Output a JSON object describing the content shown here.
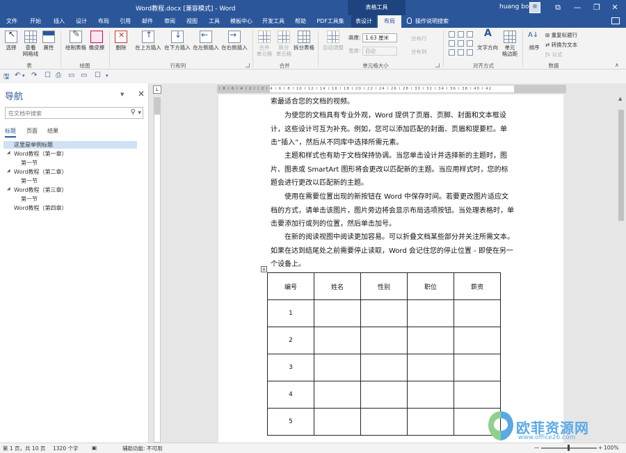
{
  "titlebar": {
    "document_title": "Word教程.docx [兼容模式] - Word",
    "contextual_group": "表格工具",
    "user_name": "huang bo",
    "controls": {
      "ribbon_options": "⧉",
      "minimize": "—",
      "restore": "❐",
      "close": "✕"
    }
  },
  "tabs": {
    "file": "文件",
    "home": "开始",
    "insert": "插入",
    "design": "设计",
    "layout": "布局",
    "references": "引用",
    "mailings": "邮件",
    "review": "审阅",
    "view": "视图",
    "tools": "工具",
    "template_center": "模板中心",
    "developer": "开发工具",
    "help": "帮助",
    "pdf_tools": "PDF工具集",
    "table_design": "表设计",
    "table_layout": "布局",
    "tell_me": "操作说明搜索"
  },
  "ribbon": {
    "table_group": {
      "label": "表",
      "select": "选择",
      "view_gridlines": "查看\n网格线",
      "properties": "属性"
    },
    "draw_group": {
      "label": "绘图",
      "draw_table": "绘制表格",
      "eraser": "橡皮擦"
    },
    "rows_cols_group": {
      "label": "行和列",
      "delete": "删除",
      "insert_above": "在上方插入",
      "insert_below": "在下方插入",
      "insert_left": "在左侧插入",
      "insert_right": "在右侧插入"
    },
    "merge_group": {
      "label": "合并",
      "merge_cells": "合并\n单元格",
      "split_cells": "拆分\n单元格",
      "split_table": "拆分表格"
    },
    "cell_size_group": {
      "label": "单元格大小",
      "autofit": "自动调整",
      "height_label": "高度:",
      "height_value": "1.63 厘米",
      "width_label": "宽度:",
      "width_value": "自动",
      "distribute_rows": "分布行",
      "distribute_cols": "分布列"
    },
    "alignment_group": {
      "label": "对齐方式",
      "text_direction": "文字方向",
      "cell_margins": "单元\n格边距"
    },
    "data_group": {
      "label": "数据",
      "sort": "排序",
      "repeat_header": "重复标题行",
      "convert_to_text": "转换为文本",
      "formula": "公式"
    }
  },
  "qat": {
    "save": "🖫",
    "undo": "↶",
    "undo_drop": "▾",
    "redo": "↷",
    "extra1": "☐",
    "extra2": "⎙",
    "extra3": "▭",
    "more": "▾"
  },
  "nav": {
    "title": "导航",
    "search_placeholder": "在文档中搜索",
    "tabs": {
      "headings": "标题",
      "pages": "页面",
      "results": "结果"
    },
    "items": [
      {
        "text": "这里是举例标题",
        "level": 1,
        "selected": true
      },
      {
        "text": "Word教程（第一章）",
        "level": 1,
        "toggle": "◢"
      },
      {
        "text": "第一节",
        "level": 2
      },
      {
        "text": "Word教程（第二章）",
        "level": 1,
        "toggle": "◢"
      },
      {
        "text": "第一节",
        "level": 2
      },
      {
        "text": "Word教程（第三章）",
        "level": 1,
        "toggle": "◢"
      },
      {
        "text": "第一节",
        "level": 2
      },
      {
        "text": "Word教程（第四章）",
        "level": 1
      }
    ]
  },
  "ruler": {
    "vertical_box": "L",
    "horizontal_ticks": "l 8 l 6 l 4 l 2 l  l 2 l 4 l 6 l 8 l 10 l 12 l 14 l 16 l 18 l 20 l 22 l 24 l 26 l 28 l 30 l 32 l 34 l 36 l 38 l 40 l 42"
  },
  "document": {
    "paragraphs": [
      {
        "text": "索最适合您的文档的视频。",
        "indent": false
      },
      {
        "text": "为使您的文档具有专业外观，Word 提供了页眉、页脚、封面和文本框设计，这些设计可互为补充。例如，您可以添加匹配的封面、页眉和提要栏。单击“插入”，然后从不同库中选择所需元素。",
        "indent": true
      },
      {
        "text": "主题和样式也有助于文档保持协调。当您单击设计并选择新的主题时，图片、图表或 SmartArt 图形将会更改以匹配新的主题。当应用样式时，您的标题会进行更改以匹配新的主题。",
        "indent": true
      },
      {
        "text": "使用在需要位置出现的新按钮在 Word 中保存时间。若要更改图片适应文档的方式，请单击该图片，图片旁边将会显示布局选项按钮。当处理表格时，单击要添加行或列的位置，然后单击加号。",
        "indent": true
      },
      {
        "text": "在新的阅读视图中阅读更加容易。可以折叠文档某些部分并关注所需文本。如果在达到结尾处之前需要停止读取，Word 会记住您的停止位置 - 即使在另一个设备上。",
        "indent": true
      }
    ],
    "table_handle": "+",
    "table": {
      "headers": [
        "编号",
        "姓名",
        "性别",
        "职位",
        "薪资"
      ],
      "rows": [
        [
          "1",
          "",
          "",
          "",
          ""
        ],
        [
          "2",
          "",
          "",
          "",
          ""
        ],
        [
          "3",
          "",
          "",
          "",
          ""
        ],
        [
          "4",
          "",
          "",
          "",
          ""
        ],
        [
          "5",
          "",
          "",
          "",
          ""
        ]
      ]
    }
  },
  "statusbar": {
    "page": "第 1 页，共 10 页",
    "words": "1320 个字",
    "accessibility": "辅助功能: 不可用",
    "zoom_minus": "—",
    "zoom_plus": "+",
    "zoom": "100%"
  },
  "watermark": {
    "brand": "欧菲资源网",
    "url": "www.office26.com"
  },
  "colors": {
    "accent": "#2b579a",
    "contextual_tab": "#1e4480",
    "ribbon_bg": "#f3f3f3",
    "canvas": "#e6e6e6"
  },
  "icons": [
    "select-icon",
    "gridlines-icon",
    "properties-icon",
    "draw-table-icon",
    "eraser-icon",
    "delete-icon",
    "insert-above-icon",
    "insert-below-icon",
    "insert-left-icon",
    "insert-right-icon",
    "merge-cells-icon",
    "split-cells-icon",
    "split-table-icon",
    "autofit-icon",
    "text-direction-icon",
    "cell-margins-icon",
    "sort-icon",
    "lightbulb-icon",
    "share-icon",
    "search-icon",
    "close-icon",
    "save-icon",
    "undo-icon",
    "redo-icon"
  ]
}
